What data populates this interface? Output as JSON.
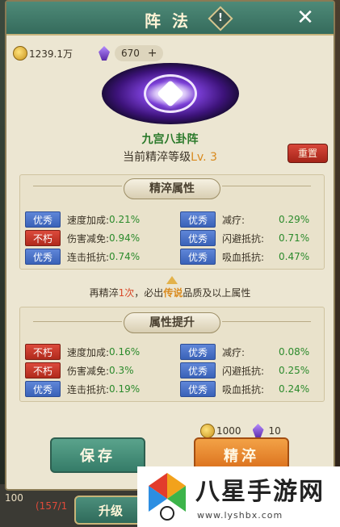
{
  "header": {
    "title": "阵法",
    "info_label": "!",
    "close_label": "✕"
  },
  "currency": {
    "gold": "1239.1万",
    "gem": "670",
    "gem_add": "+"
  },
  "formation": {
    "name": "九宫八卦阵",
    "level_prefix": "当前精淬等级",
    "level": "Lv. 3",
    "reset_label": "重置"
  },
  "refine_attrs": {
    "title": "精淬属性",
    "rows": [
      {
        "badge": "优秀",
        "quality": "blue",
        "name": "速度加成:",
        "value": "0.21%"
      },
      {
        "badge": "不朽",
        "quality": "red",
        "name": "伤害减免:",
        "value": "0.94%"
      },
      {
        "badge": "优秀",
        "quality": "blue",
        "name": "连击抵抗:",
        "value": "0.74%"
      },
      {
        "badge": "优秀",
        "quality": "blue",
        "name": "减疗:",
        "value": "0.29%"
      },
      {
        "badge": "优秀",
        "quality": "blue",
        "name": "闪避抵抗:",
        "value": "0.71%"
      },
      {
        "badge": "优秀",
        "quality": "blue",
        "name": "吸血抵抗:",
        "value": "0.47%"
      }
    ]
  },
  "notice": {
    "pre": "再精淬",
    "count": "1次",
    "mid": "，必出",
    "quality": "传说",
    "post": "品质及以上属性"
  },
  "boost_attrs": {
    "title": "属性提升",
    "rows": [
      {
        "badge": "不朽",
        "quality": "red",
        "name": "速度加成:",
        "value": "0.16%"
      },
      {
        "badge": "不朽",
        "quality": "red",
        "name": "伤害减免:",
        "value": "0.3%"
      },
      {
        "badge": "优秀",
        "quality": "blue",
        "name": "连击抵抗:",
        "value": "0.19%"
      },
      {
        "badge": "优秀",
        "quality": "blue",
        "name": "减疗:",
        "value": "0.08%"
      },
      {
        "badge": "优秀",
        "quality": "blue",
        "name": "闪避抵抗:",
        "value": "0.25%"
      },
      {
        "badge": "优秀",
        "quality": "blue",
        "name": "吸血抵抗:",
        "value": "0.24%"
      }
    ]
  },
  "cost": {
    "gold": "1000",
    "gem": "10"
  },
  "actions": {
    "save_label": "保存",
    "refine_label": "精淬"
  },
  "background": {
    "level": "100",
    "exp": "(157/1",
    "upgrade_label": "升级"
  },
  "watermark": {
    "title": "八星手游网",
    "url": "www.lyshbx.com"
  },
  "colors": {
    "accent_green": "#357c68",
    "accent_orange": "#d96d1a",
    "quality_blue": "#3a62b8",
    "quality_red": "#b02a1c",
    "value_green": "#2b8a2b"
  }
}
